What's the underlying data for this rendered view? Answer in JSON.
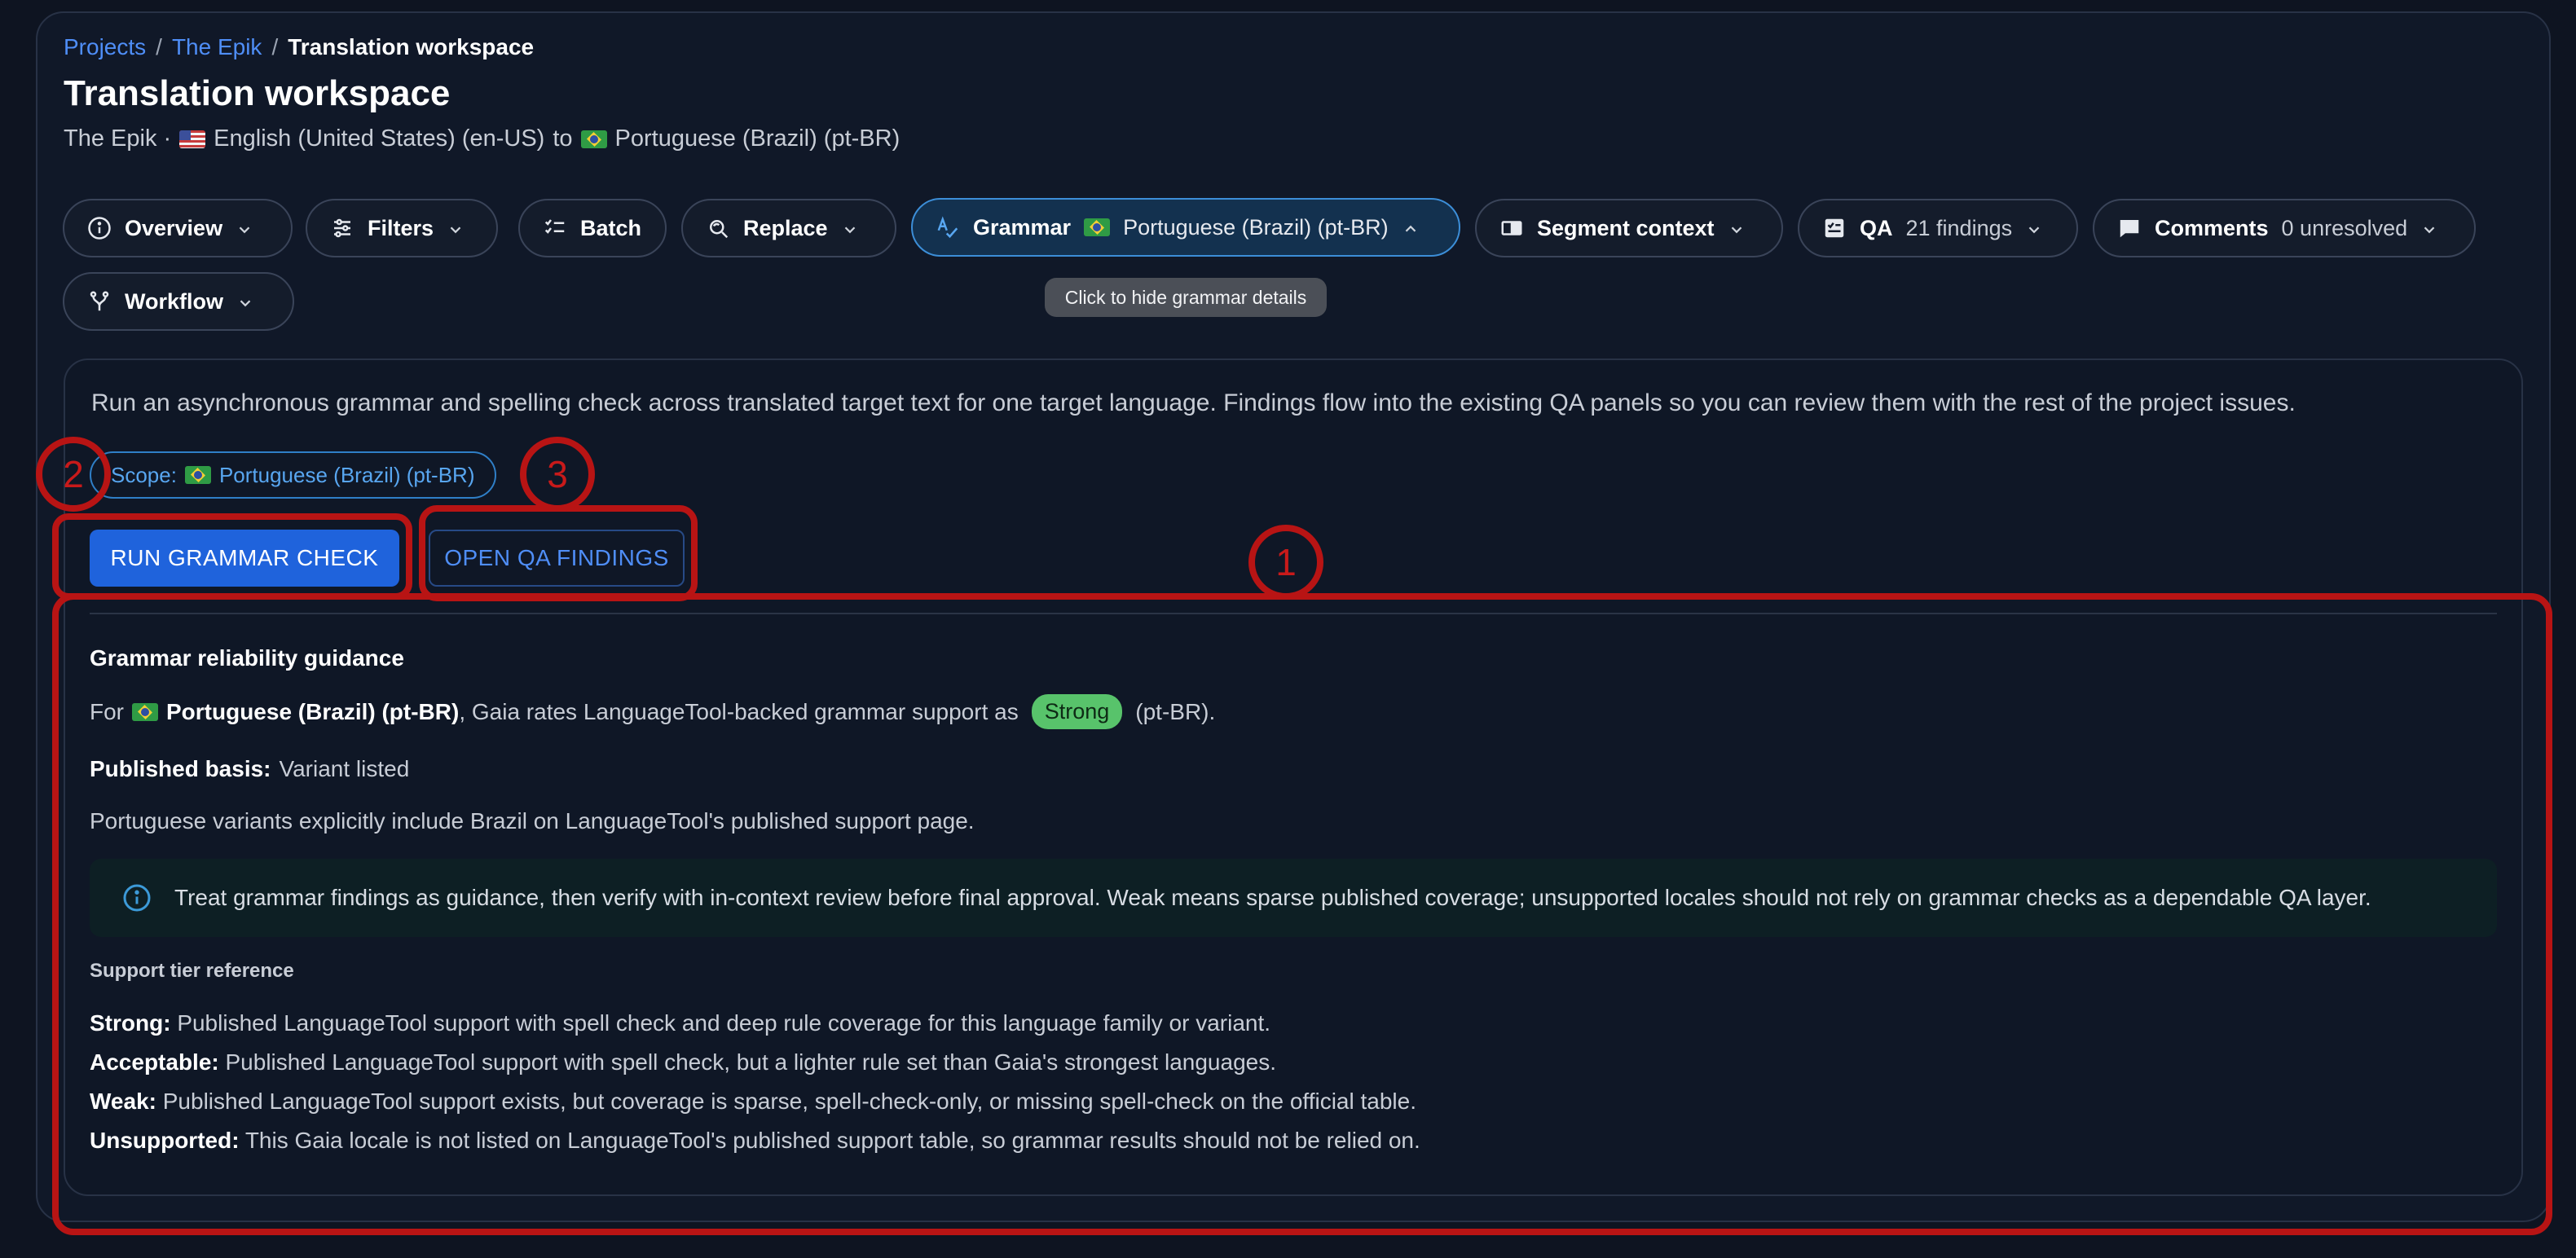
{
  "breadcrumb": {
    "items": [
      "Projects",
      "The Epik",
      "Translation workspace"
    ],
    "separator": "/"
  },
  "page_title": "Translation workspace",
  "subtitle": {
    "project": "The Epik ·",
    "source_lang": "English (United States) (en-US)",
    "connector": "to",
    "target_lang": "Portuguese (Brazil) (pt-BR)"
  },
  "toolbar": {
    "overview": "Overview",
    "filters": "Filters",
    "batch": "Batch",
    "replace": "Replace",
    "grammar": "Grammar",
    "grammar_lang": "Portuguese (Brazil) (pt-BR)",
    "segment_context": "Segment context",
    "qa": "QA",
    "qa_count": "21 findings",
    "comments": "Comments",
    "comments_count": "0 unresolved",
    "workflow": "Workflow"
  },
  "tooltip": "Click to hide grammar details",
  "panel": {
    "description": "Run an asynchronous grammar and spelling check across translated target text for one target language. Findings flow into the existing QA panels so you can review them with the rest of the project issues.",
    "scope_label": "Scope:",
    "scope_lang": "Portuguese (Brazil) (pt-BR)",
    "run_button": "RUN GRAMMAR CHECK",
    "open_button": "OPEN QA FINDINGS"
  },
  "guidance": {
    "heading": "Grammar reliability guidance",
    "for_prefix": "For",
    "for_lang": "Portuguese (Brazil) (pt-BR)",
    "for_mid": ", Gaia rates LanguageTool-backed grammar support as",
    "rating": "Strong",
    "for_suffix": "(pt-BR).",
    "basis_label": "Published basis:",
    "basis_value": "Variant listed",
    "variant_note": "Portuguese variants explicitly include Brazil on LanguageTool's published support page.",
    "alert": "Treat grammar findings as guidance, then verify with in-context review before final approval. Weak means sparse published coverage; unsupported locales should not rely on grammar checks as a dependable QA layer."
  },
  "tiers": {
    "heading": "Support tier reference",
    "items": [
      {
        "label": "Strong:",
        "text": "Published LanguageTool support with spell check and deep rule coverage for this language family or variant."
      },
      {
        "label": "Acceptable:",
        "text": "Published LanguageTool support with spell check, but a lighter rule set than Gaia's strongest languages."
      },
      {
        "label": "Weak:",
        "text": "Published LanguageTool support exists, but coverage is sparse, spell-check-only, or missing spell-check on the official table."
      },
      {
        "label": "Unsupported:",
        "text": "This Gaia locale is not listed on LanguageTool's published support table, so grammar results should not be relied on."
      }
    ]
  },
  "annotations": [
    "1",
    "2",
    "3"
  ],
  "colors": {
    "accent": "#1f63dc",
    "link": "#4f8ef7",
    "strong_badge": "#58c36b",
    "annotation": "#b81414"
  }
}
